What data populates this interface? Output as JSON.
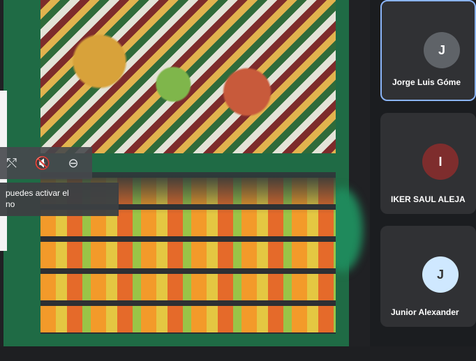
{
  "overlay_controls": {
    "pin_icon": "pin-off-icon",
    "mute_icon": "mic-off-icon",
    "remove_icon": "minus-circle-icon",
    "pin_glyph": "⤲",
    "mute_glyph": "🔇",
    "remove_glyph": "⊖"
  },
  "tooltip": {
    "line1": "puedes activar el",
    "line2": "no"
  },
  "participants": [
    {
      "name": "Jorge Luis Góme",
      "initial": "J"
    },
    {
      "name": "IKER SAUL ALEJA",
      "initial": "I"
    },
    {
      "name": "Junior Alexander",
      "initial": "J"
    }
  ],
  "colors": {
    "active_speaker_border": "#8ab4f8",
    "slide_green": "#1f6b45",
    "tile_bg": "#303134"
  }
}
